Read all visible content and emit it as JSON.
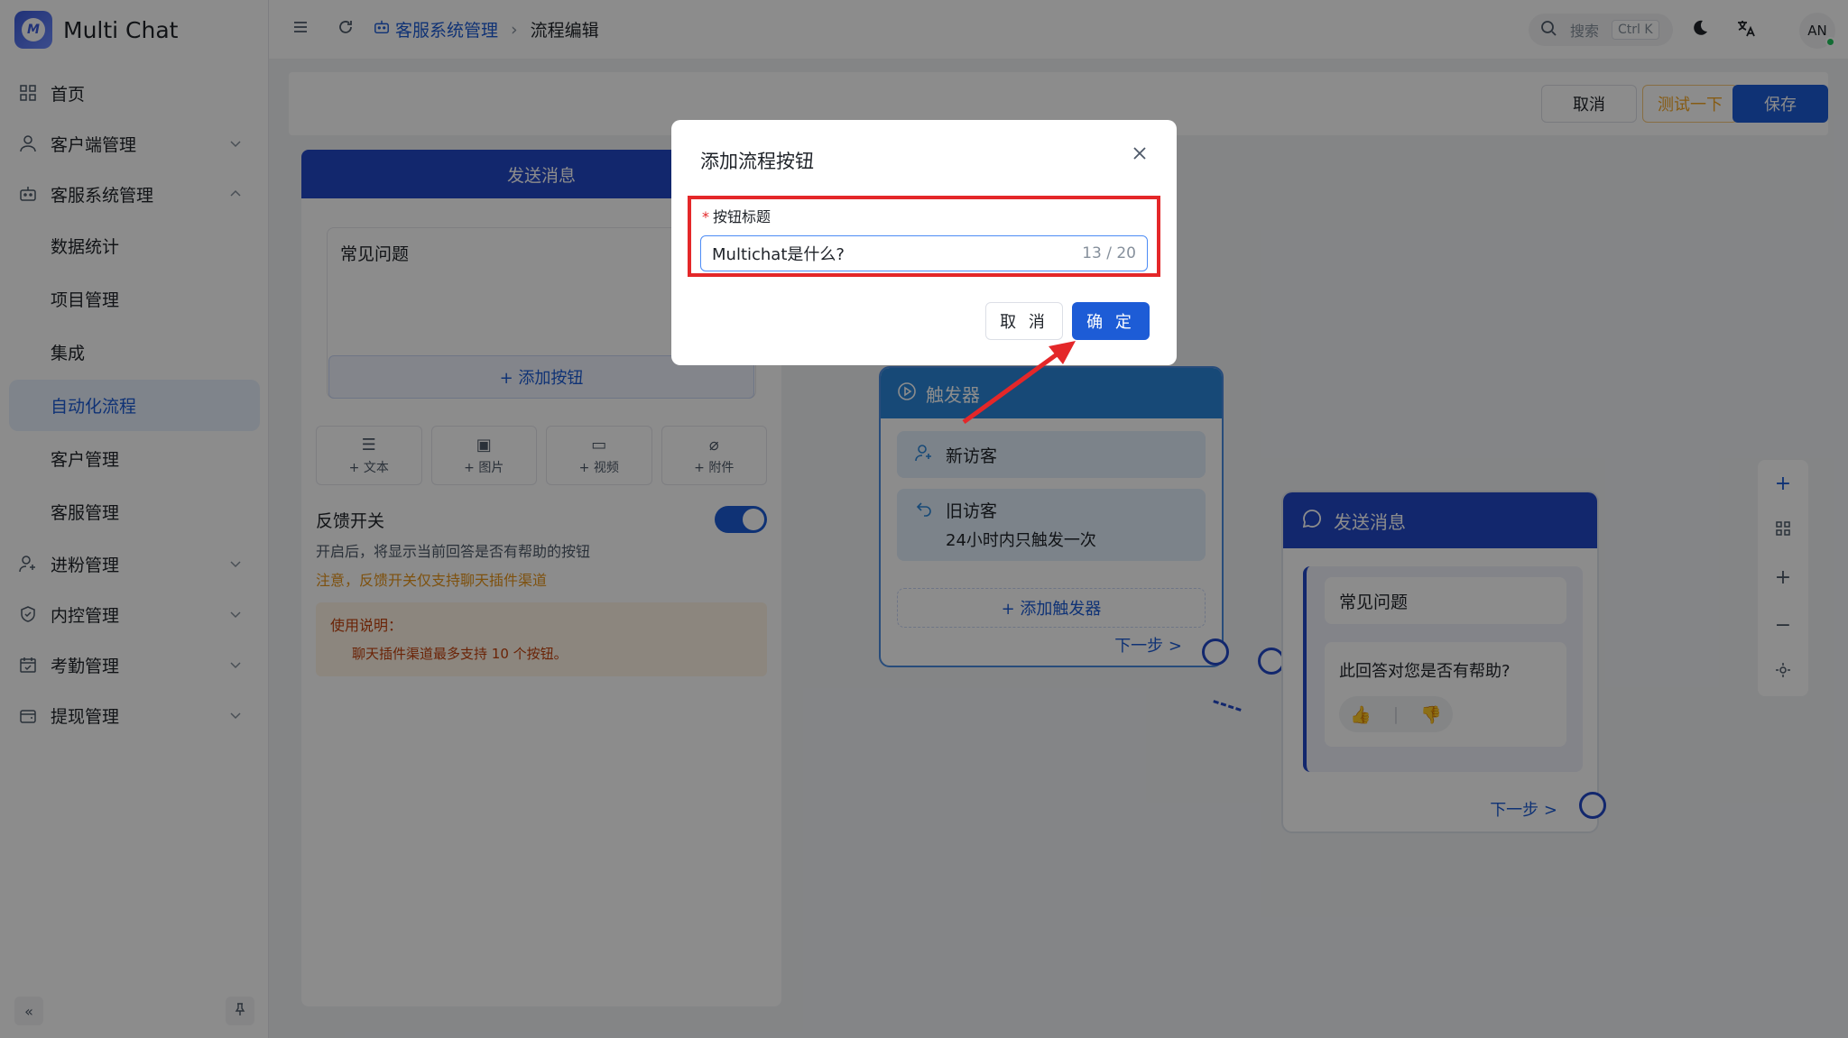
{
  "app": {
    "title": "Multi Chat",
    "logo_letter": "M"
  },
  "sidebar": {
    "items": [
      {
        "label": "首页",
        "icon": "dashboard-icon"
      },
      {
        "label": "客户端管理",
        "icon": "user-icon"
      },
      {
        "label": "客服系统管理",
        "icon": "robot-icon"
      },
      {
        "label": "数据统计"
      },
      {
        "label": "项目管理"
      },
      {
        "label": "集成"
      },
      {
        "label": "自动化流程"
      },
      {
        "label": "客户管理"
      },
      {
        "label": "客服管理"
      },
      {
        "label": "进粉管理",
        "icon": "user-add-icon"
      },
      {
        "label": "内控管理",
        "icon": "shield-icon"
      },
      {
        "label": "考勤管理",
        "icon": "calendar-icon"
      },
      {
        "label": "提现管理",
        "icon": "wallet-icon"
      }
    ]
  },
  "header": {
    "breadcrumb_root": "客服系统管理",
    "breadcrumb_current": "流程编辑",
    "search_placeholder": "搜索",
    "search_shortcut": "Ctrl K",
    "avatar": "AN"
  },
  "toolbar": {
    "cancel_label": "取消",
    "test_label": "测试一下",
    "save_label": "保存"
  },
  "editor": {
    "title": "发送消息",
    "message_text": "常见问题",
    "add_button_label": "+ 添加按钮",
    "tools": [
      "+ 文本",
      "+ 图片",
      "+ 视频",
      "+ 附件"
    ],
    "feedback_label": "反馈开关",
    "feedback_desc": "开启后，将显示当前回答是否有帮助的按钮",
    "feedback_warning": "注意，反馈开关仅支持聊天插件渠道",
    "notice_title": "使用说明：",
    "notice_text": "聊天插件渠道最多支持 10 个按钮。"
  },
  "trigger_node": {
    "title": "触发器",
    "item1": "新访客",
    "item2_title": "旧访客",
    "item2_desc": "24小时内只触发一次",
    "add_label": "+ 添加触发器",
    "next_label": "下一步 >"
  },
  "send_node": {
    "title": "发送消息",
    "question": "常见问题",
    "feedback_question": "此回答对您是否有帮助?",
    "next_label": "下一步 >"
  },
  "dialog": {
    "title": "添加流程按钮",
    "field_label": "按钮标题",
    "field_value": "Multichat是什么?",
    "counter": "13 / 20",
    "cancel_label": "取 消",
    "ok_label": "确 定"
  },
  "colors": {
    "primary": "#1d5cd6",
    "annotation_red": "#e42729"
  }
}
